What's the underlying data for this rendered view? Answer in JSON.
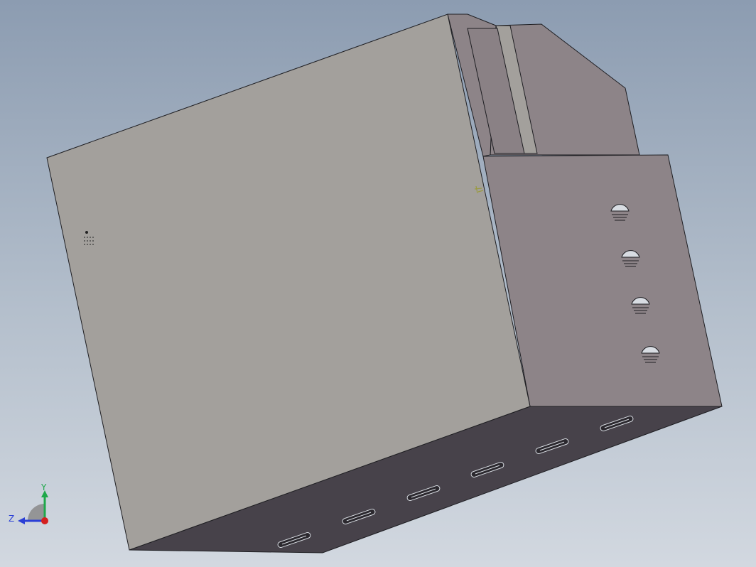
{
  "viewport": {
    "background_top": "#8c9cb1",
    "background_bottom": "#d2d8e0"
  },
  "model": {
    "colors": {
      "front_face": "#a3a09c",
      "right_face": "#8d8488",
      "bottom_face": "#47424a",
      "upper_block": "#8d8488",
      "slot_highlight": "#a3a09c",
      "edge": "#1e1e22"
    },
    "right_face_hole_count": 4,
    "bottom_face_slot_count": 6
  },
  "triad": {
    "y_label": "Y",
    "z_label": "Z",
    "y_color": "#1fa84a",
    "z_color": "#2a3fd6",
    "x_color": "#d41f1f"
  }
}
